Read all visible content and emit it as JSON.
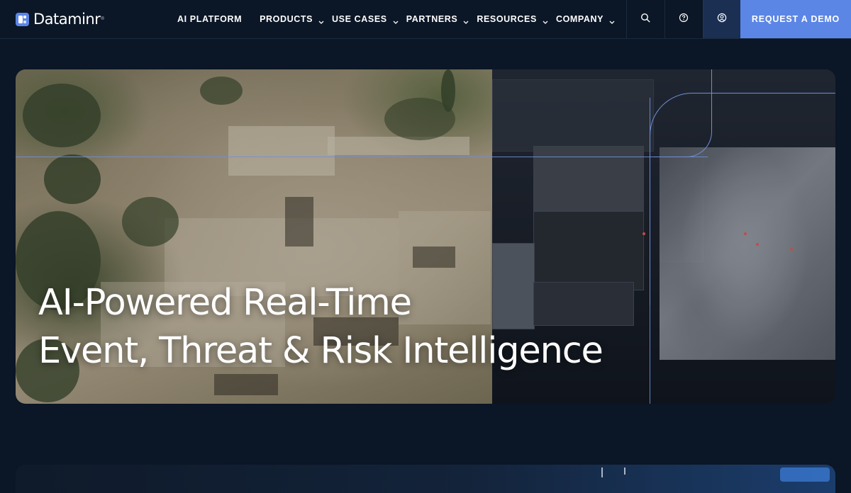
{
  "brand": {
    "name": "Dataminr",
    "trademark": "®",
    "logo_icon": "dataminr-logo-icon",
    "accent_color": "#5b86e6"
  },
  "nav": {
    "items": [
      {
        "label": "AI PLATFORM",
        "has_dropdown": false
      },
      {
        "label": "PRODUCTS",
        "has_dropdown": true
      },
      {
        "label": "USE CASES",
        "has_dropdown": true
      },
      {
        "label": "PARTNERS",
        "has_dropdown": true
      },
      {
        "label": "RESOURCES",
        "has_dropdown": true
      },
      {
        "label": "COMPANY",
        "has_dropdown": true
      }
    ],
    "icons": [
      "search-icon",
      "help-icon",
      "user-icon"
    ],
    "cta_label": "REQUEST A DEMO"
  },
  "hero": {
    "title_line1": "AI-Powered Real-Time",
    "title_line2": "Event, Threat & Risk Intelligence"
  }
}
